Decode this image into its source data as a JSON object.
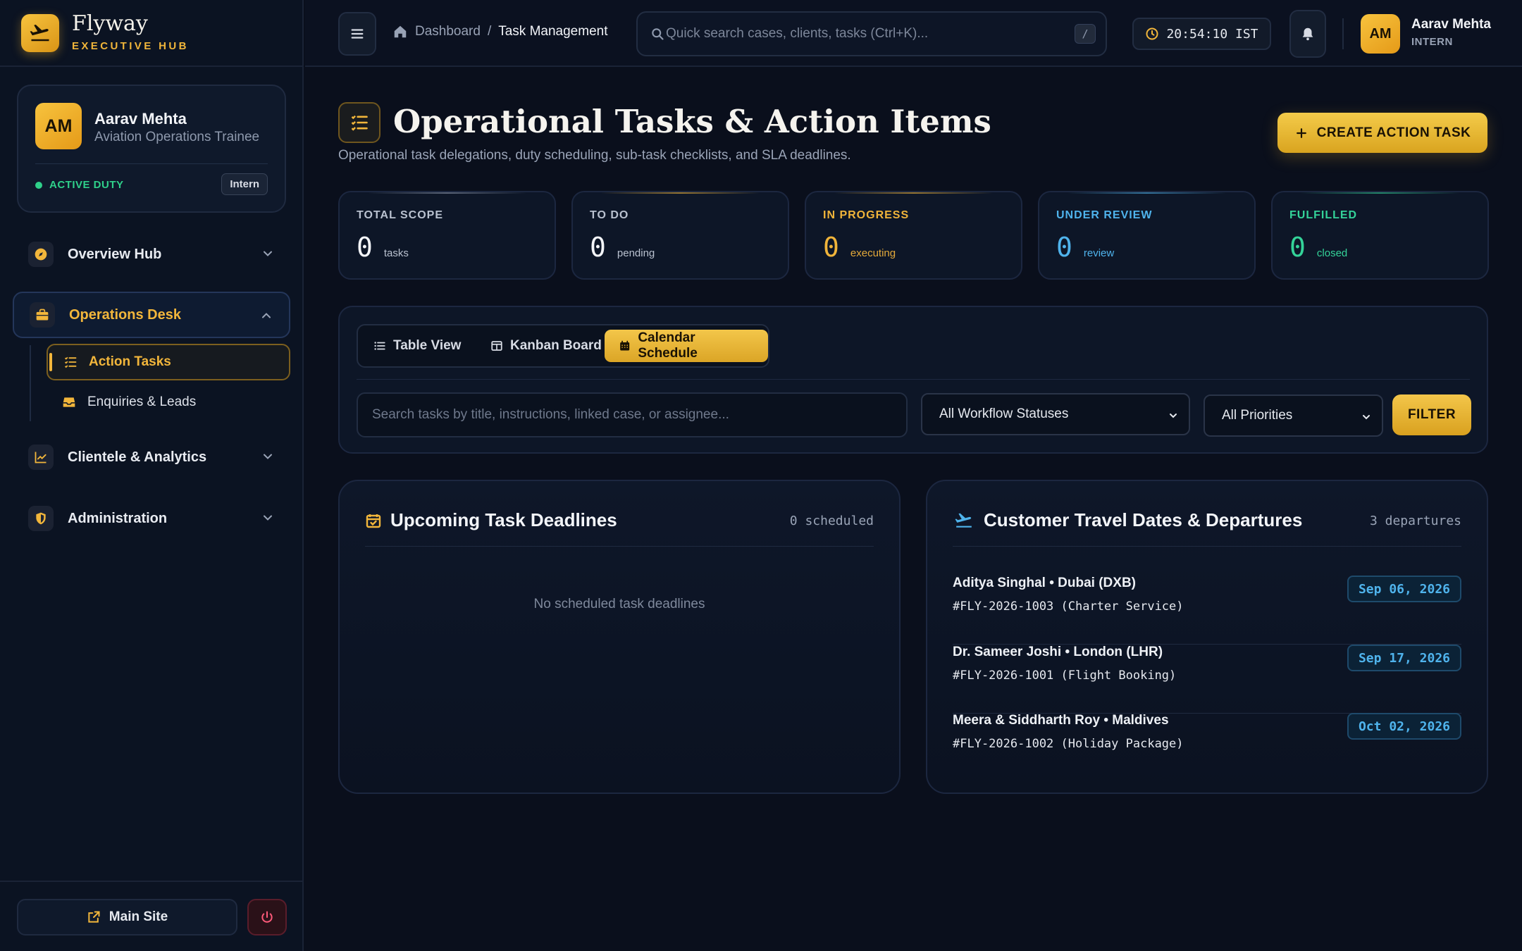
{
  "brand": {
    "name": "Flyway",
    "subtitle": "EXECUTIVE HUB"
  },
  "profile": {
    "initials": "AM",
    "name": "Aarav Mehta",
    "role": "Aviation Operations Trainee",
    "duty_status": "ACTIVE DUTY",
    "badge": "Intern"
  },
  "nav": {
    "overview": "Overview Hub",
    "operations": "Operations Desk",
    "operations_items": [
      "Action Tasks",
      "Enquiries & Leads"
    ],
    "clientele": "Clientele & Analytics",
    "administration": "Administration"
  },
  "footer": {
    "main_site": "Main Site"
  },
  "header": {
    "breadcrumb_home": "Dashboard",
    "breadcrumb_sep": "/",
    "breadcrumb_current": "Task Management",
    "search_placeholder": "Quick search cases, clients, tasks (Ctrl+K)...",
    "search_shortcut": "/",
    "clock": "20:54:10 IST",
    "user_initials": "AM",
    "user_name": "Aarav Mehta",
    "user_role": "INTERN"
  },
  "page": {
    "title": "Operational Tasks & Action Items",
    "subtitle": "Operational task delegations, duty scheduling, sub-task checklists, and SLA deadlines.",
    "create_button": "CREATE ACTION TASK"
  },
  "stats": [
    {
      "label": "TOTAL SCOPE",
      "value": "0",
      "unit": "tasks"
    },
    {
      "label": "TO DO",
      "value": "0",
      "unit": "pending"
    },
    {
      "label": "IN PROGRESS",
      "value": "0",
      "unit": "executing"
    },
    {
      "label": "UNDER REVIEW",
      "value": "0",
      "unit": "review"
    },
    {
      "label": "FULFILLED",
      "value": "0",
      "unit": "closed"
    }
  ],
  "colors": {
    "accent": "#f2b63b",
    "in_progress": "#f0b43a",
    "under_review": "#4fb3ec",
    "fulfilled": "#34d399",
    "neutral": "#b9c1cf"
  },
  "views": {
    "table": "Table View",
    "kanban": "Kanban Board",
    "calendar": "Calendar Schedule",
    "active": "calendar"
  },
  "filters": {
    "search_placeholder": "Search tasks by title, instructions, linked case, or assignee...",
    "status_selected": "All Workflow Statuses",
    "priority_selected": "All Priorities",
    "filter_button": "FILTER"
  },
  "deadlines": {
    "title": "Upcoming Task Deadlines",
    "count": "0 scheduled",
    "empty": "No scheduled task deadlines"
  },
  "departures": {
    "title": "Customer Travel Dates & Departures",
    "count": "3 departures",
    "items": [
      {
        "title": "Aditya Singhal • Dubai (DXB)",
        "ref": "#FLY-2026-1003 (Charter Service)",
        "date": "Sep 06, 2026"
      },
      {
        "title": "Dr. Sameer Joshi • London (LHR)",
        "ref": "#FLY-2026-1001 (Flight Booking)",
        "date": "Sep 17, 2026"
      },
      {
        "title": "Meera & Siddharth Roy • Maldives",
        "ref": "#FLY-2026-1002 (Holiday Package)",
        "date": "Oct 02, 2026"
      }
    ]
  },
  "icons": {
    "brand": "plane-departure-icon",
    "overview": "compass-icon",
    "operations": "briefcase-icon",
    "action_tasks": "list-check-icon",
    "enquiries": "inbox-icon",
    "clientele": "chart-line-icon",
    "administration": "shield-icon",
    "main_site": "external-link-icon",
    "logout": "power-icon",
    "menu": "hamburger-icon",
    "home": "home-icon",
    "search": "search-icon",
    "clock": "clock-icon",
    "bell": "bell-icon",
    "calendar_check": "calendar-check-icon",
    "departure": "plane-departure-icon"
  }
}
